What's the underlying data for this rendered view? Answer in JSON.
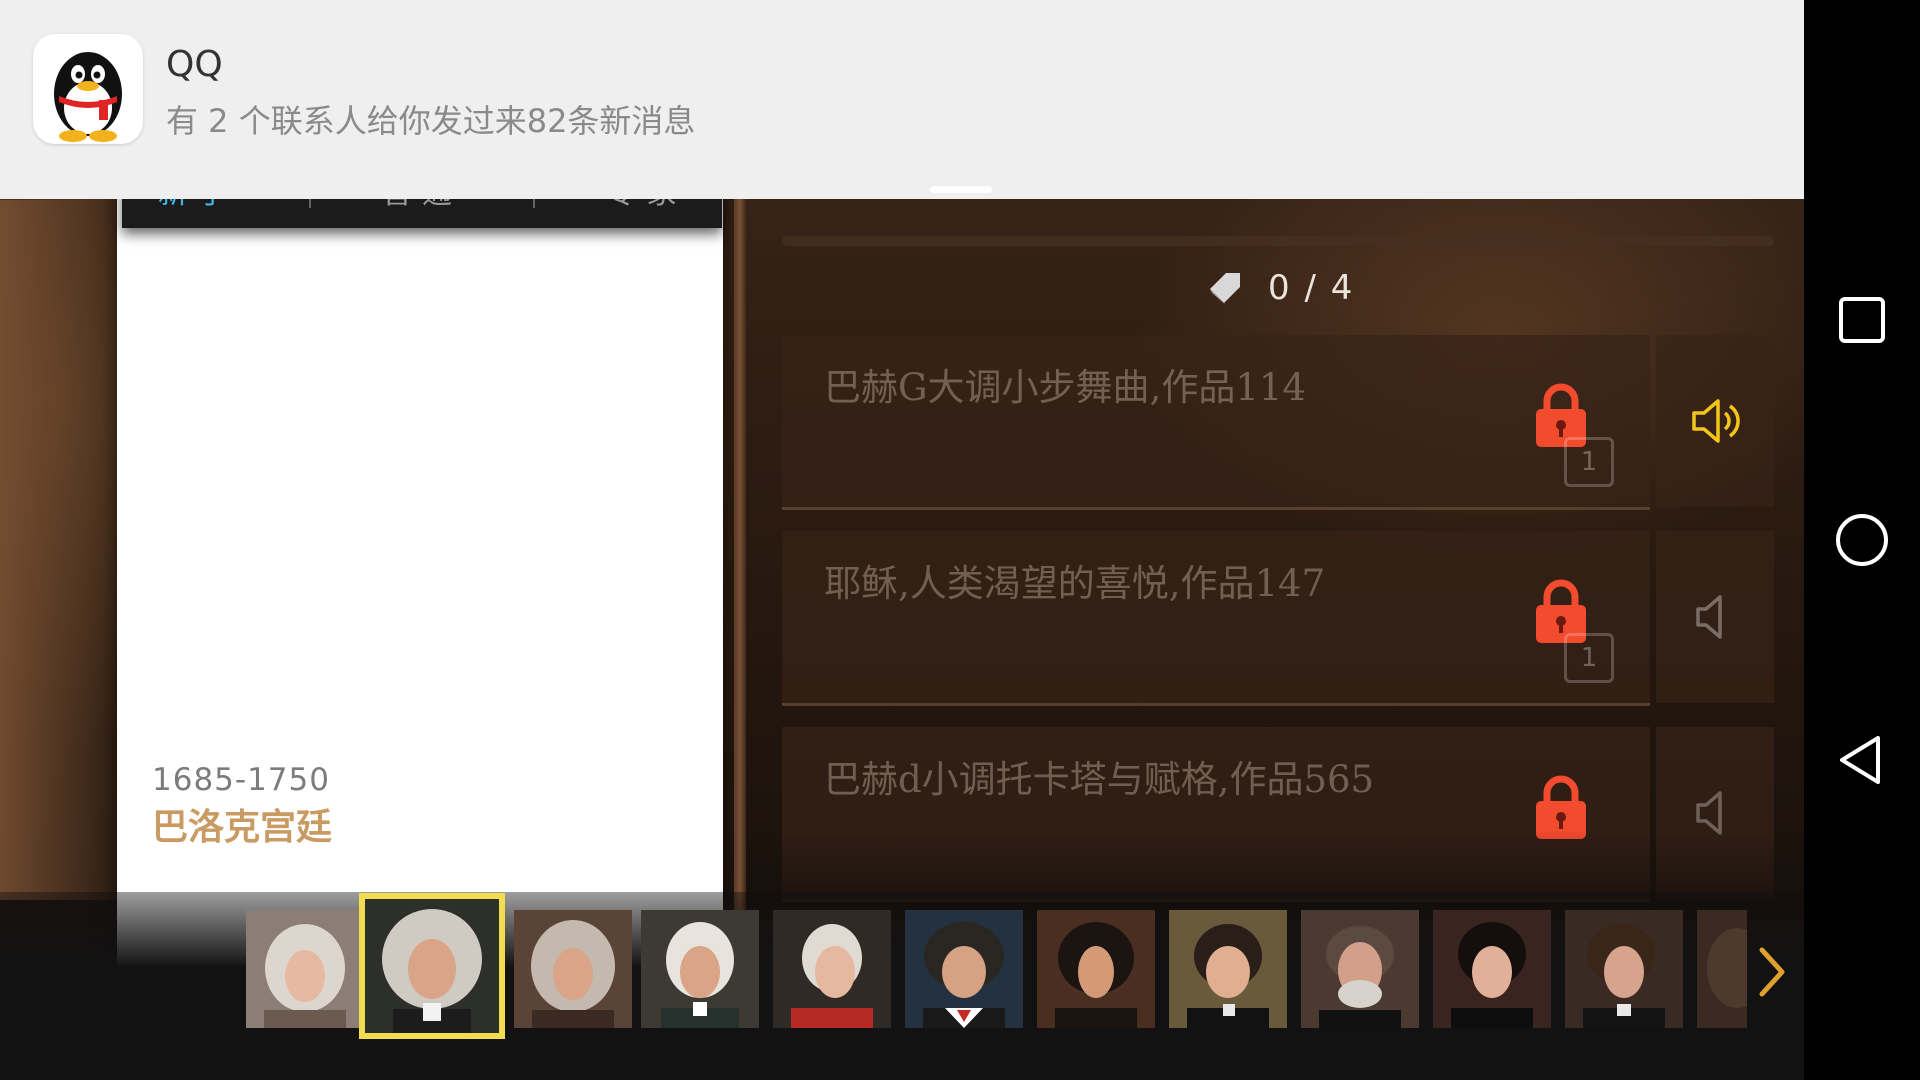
{
  "notification": {
    "app_name": "QQ",
    "message": "有 2 个联系人给你发过来82条新消息",
    "icon": "qq-penguin-icon"
  },
  "card": {
    "tabs": [
      "新手",
      "普通",
      "专家"
    ],
    "era_years": "1685-1750",
    "era_name": "巴洛克宫廷"
  },
  "progress": {
    "icon": "tag-icon",
    "text": "0 / 4"
  },
  "songs": [
    {
      "title": "巴赫G大调小步舞曲,作品114",
      "badge": "1",
      "locked": true,
      "speaker_active": true
    },
    {
      "title": "耶稣,人类渴望的喜悦,作品147",
      "badge": "1",
      "locked": true,
      "speaker_active": false
    },
    {
      "title": "巴赫d小调托卡塔与赋格,作品565",
      "badge": "",
      "locked": true,
      "speaker_active": false
    }
  ],
  "composers": {
    "count": 12,
    "selected_index": 1,
    "next_icon": "chevron-right-icon"
  },
  "navbar": {
    "icons": [
      "recents-square-icon",
      "home-circle-icon",
      "back-triangle-icon"
    ]
  },
  "colors": {
    "accent_tab": "#3fb6e8",
    "era_name": "#c99a62",
    "lock": "#f24b2e",
    "speaker_active": "#f5c518",
    "selected_border": "#f2dd50"
  }
}
